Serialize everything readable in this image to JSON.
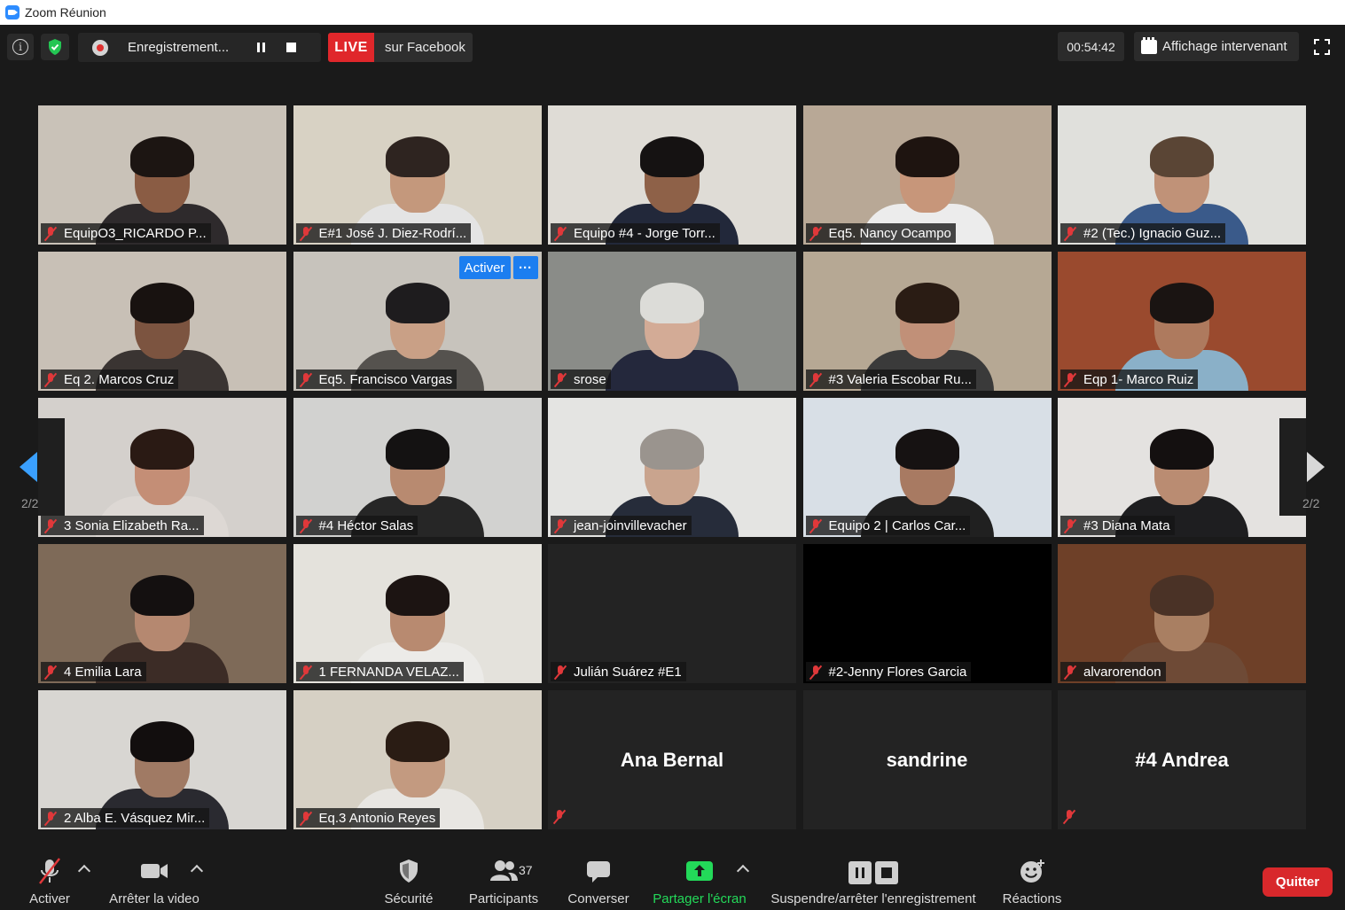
{
  "window": {
    "title": "Zoom Réunion"
  },
  "topbar": {
    "info_icon": "info-icon",
    "security_icon": "shield-check-icon",
    "recording_label": "Enregistrement...",
    "live_badge": "LIVE",
    "live_destination": "sur Facebook",
    "timer": "00:54:42",
    "view_label": "Affichage intervenant"
  },
  "tiles": [
    {
      "name": "EquipO3_RICARDO P...",
      "muted": true,
      "video": true,
      "bg": "#c9c2b8",
      "skin": "#8a5c44",
      "hair": "#1c1512",
      "shirt": "#2e2a2c"
    },
    {
      "name": "E#1 José J. Diez-Rodrí...",
      "muted": true,
      "video": true,
      "bg": "#d8d2c4",
      "skin": "#c4987c",
      "hair": "#2e2420",
      "shirt": "#e4e4e4"
    },
    {
      "name": "Equipo #4 - Jorge Torr...",
      "muted": true,
      "video": true,
      "bg": "#dfdcd6",
      "skin": "#8e6148",
      "hair": "#151212",
      "shirt": "#22283a"
    },
    {
      "name": "Eq5. Nancy Ocampo",
      "muted": true,
      "video": true,
      "bg": "#b8a896",
      "skin": "#c7967a",
      "hair": "#1e1410",
      "shirt": "#ececec"
    },
    {
      "name": "#2 (Tec.) Ignacio Guz...",
      "muted": true,
      "video": true,
      "bg": "#e0e0dc",
      "skin": "#c09278",
      "hair": "#5a4535",
      "shirt": "#3a5a8a"
    },
    {
      "name": "Eq 2. Marcos Cruz",
      "muted": true,
      "video": true,
      "bg": "#c8c0b6",
      "skin": "#7c5440",
      "hair": "#181210",
      "shirt": "#3a3432"
    },
    {
      "name": "Eq5. Francisco Vargas",
      "muted": true,
      "video": true,
      "bg": "#c7c3bc",
      "skin": "#c9a086",
      "hair": "#1e1c1e",
      "shirt": "#55524e",
      "spotlight": true
    },
    {
      "name": "srose",
      "muted": true,
      "video": true,
      "bg": "#8a8c88",
      "skin": "#d3ab96",
      "hair": "#dcdcd8",
      "shirt": "#24283c"
    },
    {
      "name": "#3 Valeria Escobar Ru...",
      "muted": true,
      "video": true,
      "bg": "#b6a894",
      "skin": "#c19078",
      "hair": "#2a1c14",
      "shirt": "#3a3a3a"
    },
    {
      "name": "Eqp 1- Marco Ruiz",
      "muted": true,
      "video": true,
      "bg": "#9a4a2e",
      "skin": "#ae7a5e",
      "hair": "#1a1412",
      "shirt": "#8ab0c8"
    },
    {
      "name": "3 Sonia Elizabeth Ra...",
      "muted": true,
      "video": true,
      "bg": "#d4d0cc",
      "skin": "#c48e76",
      "hair": "#2a1a14",
      "shirt": "#ddd8d4"
    },
    {
      "name": "#4 Héctor Salas",
      "muted": true,
      "video": true,
      "bg": "#d2d2d0",
      "skin": "#b88a70",
      "hair": "#141212",
      "shirt": "#262626"
    },
    {
      "name": "jean-joinvillevacher",
      "muted": true,
      "video": true,
      "bg": "#e4e4e2",
      "skin": "#c9a48e",
      "hair": "#9a948e",
      "shirt": "#262c3a"
    },
    {
      "name": "Equipo 2 | Carlos Car...",
      "muted": true,
      "video": true,
      "bg": "#d8dfe6",
      "skin": "#a87a62",
      "hair": "#161212",
      "shirt": "#202020"
    },
    {
      "name": "#3 Diana Mata",
      "muted": true,
      "video": true,
      "bg": "#e4e2e0",
      "skin": "#ba8c72",
      "hair": "#141010",
      "shirt": "#1e1e20"
    },
    {
      "name": "4 Emilia Lara",
      "muted": true,
      "video": true,
      "bg": "#7e6a58",
      "skin": "#b58870",
      "hair": "#141010",
      "shirt": "#3c2c26"
    },
    {
      "name": "1 FERNANDA VELAZ...",
      "muted": true,
      "video": true,
      "bg": "#e4e2dc",
      "skin": "#b88a70",
      "hair": "#1c1412",
      "shirt": "#ecebe8"
    },
    {
      "name": "Julián Suárez #E1",
      "muted": true,
      "video": false,
      "bg": "#232323"
    },
    {
      "name": "#2-Jenny Flores Garcia",
      "muted": true,
      "video": false,
      "bg": "#000000"
    },
    {
      "name": "alvarorendon",
      "muted": true,
      "video": true,
      "bg": "#6e4028",
      "skin": "#a97f62",
      "hair": "#4a3226",
      "shirt": "#6e4a36"
    },
    {
      "name": "2 Alba E. Vásquez Mir...",
      "muted": true,
      "video": true,
      "bg": "#d8d6d2",
      "skin": "#a07a64",
      "hair": "#120e0e",
      "shirt": "#2a2a30"
    },
    {
      "name": "Eq.3 Antonio Reyes",
      "muted": true,
      "video": true,
      "bg": "#d6d0c4",
      "skin": "#c39a80",
      "hair": "#2a1c14",
      "shirt": "#e8e6e2"
    },
    {
      "name": "Ana Bernal",
      "muted": true,
      "video": false,
      "name_only": true,
      "bg": "#232323"
    },
    {
      "name": "sandrine",
      "muted": false,
      "video": false,
      "name_only": true,
      "bg": "#232323"
    },
    {
      "name": "#4 Andrea",
      "muted": true,
      "video": false,
      "name_only": true,
      "bg": "#232323"
    }
  ],
  "spotlight_menu": {
    "activate_label": "Activer",
    "more_label": "···"
  },
  "pagination": {
    "left": "2/2",
    "right": "2/2"
  },
  "bottombar": {
    "mute_label": "Activer",
    "video_label": "Arrêter la video",
    "security_label": "Sécurité",
    "participants_label": "Participants",
    "participants_count": "37",
    "chat_label": "Converser",
    "share_label": "Partager l'écran",
    "record_label": "Suspendre/arrêter l'enregistrement",
    "reactions_label": "Réactions",
    "quit_label": "Quitter"
  },
  "colors": {
    "share_green": "#23d959",
    "live_red": "#e0272b",
    "quit_red": "#d8282b",
    "spotlight_blue": "#1c7ef0",
    "mute_red": "#e0383a"
  }
}
